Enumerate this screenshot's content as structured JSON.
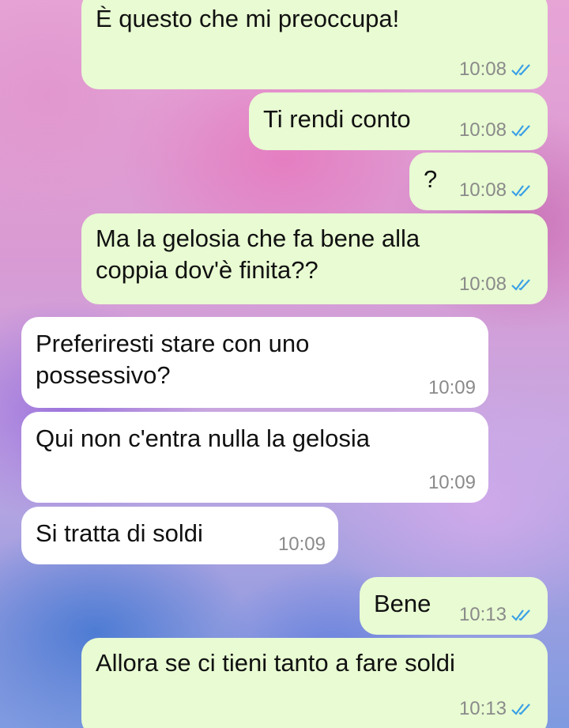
{
  "messages": [
    {
      "text": "È questo che mi preoccupa!",
      "time": "10:08",
      "read": true
    },
    {
      "text": "Ti rendi conto",
      "time": "10:08",
      "read": true
    },
    {
      "text": "?",
      "time": "10:08",
      "read": true
    },
    {
      "text": "Ma la gelosia che fa bene alla\ncoppia dov'è finita??",
      "time": "10:08",
      "read": true
    },
    {
      "text": "Preferiresti stare con uno\npossessivo?",
      "time": "10:09"
    },
    {
      "text": "Qui non c'entra nulla la gelosia",
      "time": "10:09"
    },
    {
      "text": "Si tratta di soldi",
      "time": "10:09"
    },
    {
      "text": "Bene",
      "time": "10:13",
      "read": true
    },
    {
      "text": "Allora se ci tieni tanto a fare soldi",
      "time": "10:13",
      "read": true
    }
  ],
  "colors": {
    "outgoing_bubble": "#e8fbd2",
    "incoming_bubble": "#ffffff",
    "read_ticks": "#3aa0e6",
    "timestamp": "#8a8a8a"
  },
  "icons": {
    "read_receipt": "double-check-icon"
  }
}
